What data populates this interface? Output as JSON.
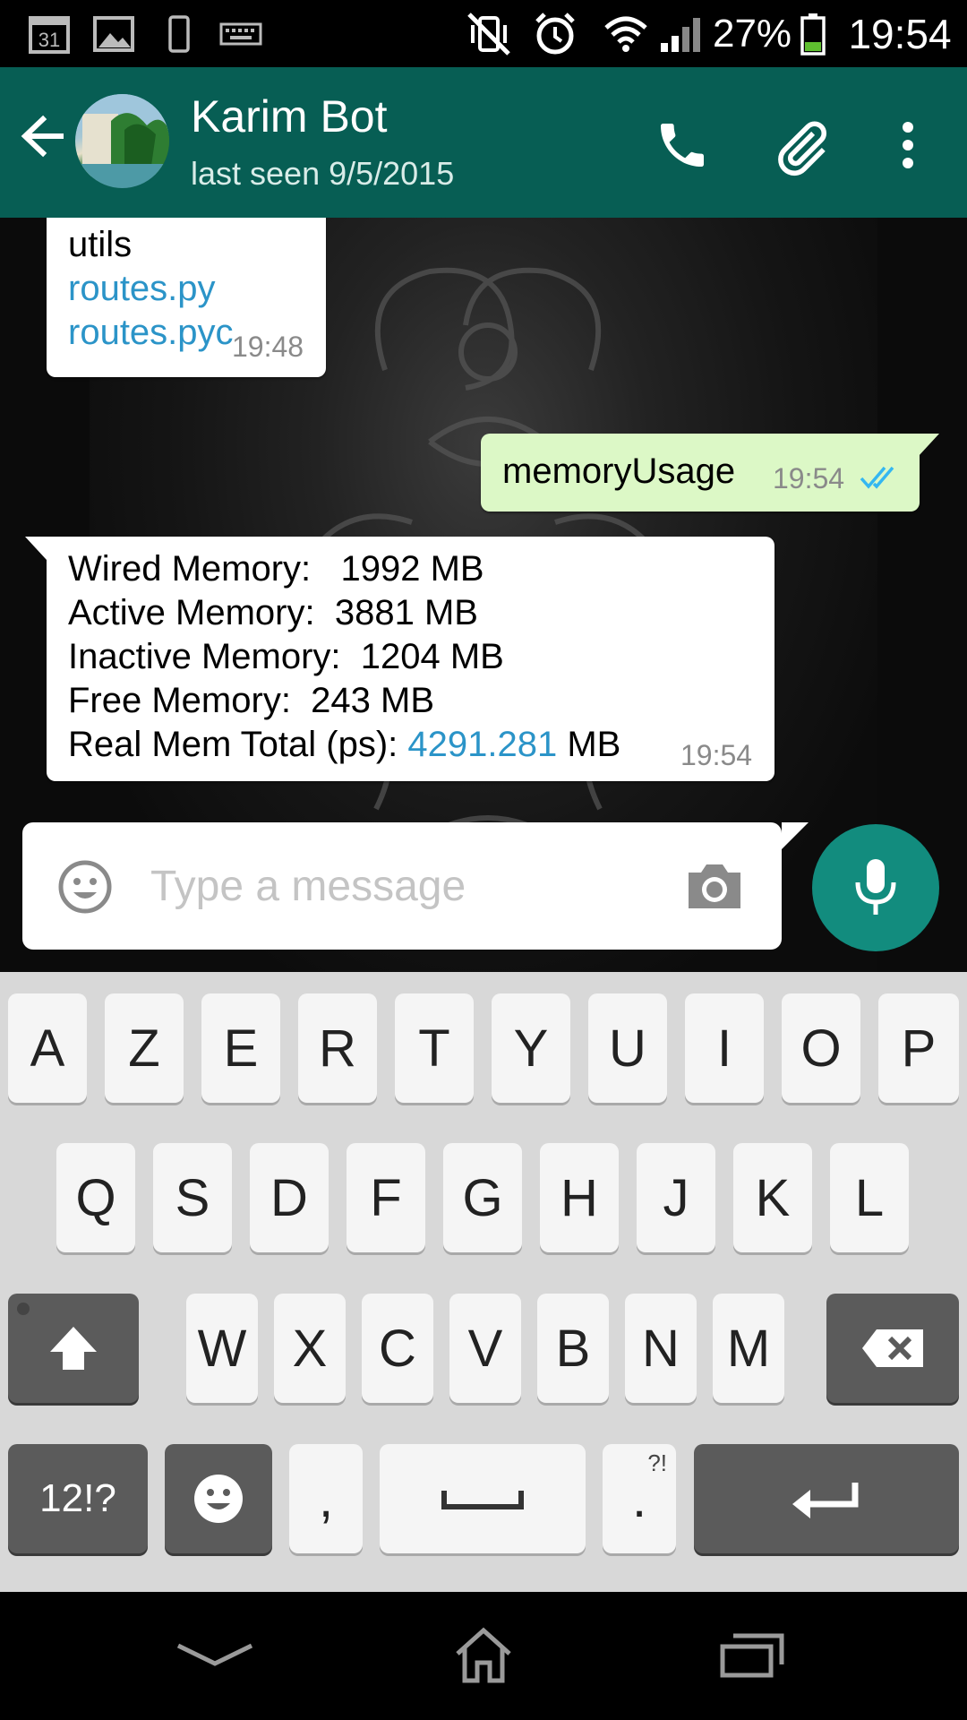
{
  "status_bar": {
    "battery": "27%",
    "time": "19:54",
    "calendar_day": "31"
  },
  "header": {
    "contact_name": "Karim Bot",
    "last_seen": "last seen 9/5/2015"
  },
  "messages": [
    {
      "direction": "incoming",
      "lines": [
        "utils",
        "routes.py",
        "routes.pyc"
      ],
      "time": "19:48"
    },
    {
      "direction": "outgoing",
      "text": "memoryUsage",
      "time": "19:54",
      "status": "read"
    },
    {
      "direction": "incoming",
      "lines": [
        {
          "label": "Wired Memory:",
          "value": "1992 MB"
        },
        {
          "label": "Active Memory:",
          "value": "3881 MB"
        },
        {
          "label": "Inactive Memory:",
          "value": "1204 MB"
        },
        {
          "label": "Free Memory:",
          "value": "243 MB"
        },
        {
          "label": "Real Mem Total (ps):",
          "link_value": "4291.281",
          "unit": "MB"
        }
      ],
      "time": "19:54"
    }
  ],
  "composer": {
    "placeholder": "Type a message"
  },
  "keyboard": {
    "row1": [
      "A",
      "Z",
      "E",
      "R",
      "T",
      "Y",
      "U",
      "I",
      "O",
      "P"
    ],
    "row2": [
      "Q",
      "S",
      "D",
      "F",
      "G",
      "H",
      "J",
      "K",
      "L"
    ],
    "row3": [
      "W",
      "X",
      "C",
      "V",
      "B",
      "N",
      "M"
    ],
    "symbols_label": "12!?",
    "comma": ",",
    "period": ".",
    "period_hint": "?!"
  },
  "colors": {
    "app_bar": "#075e54",
    "accent": "#128c7e",
    "outgoing_bubble": "#dcf8c6",
    "link": "#2b94c8",
    "read_ticks": "#34b7f1"
  }
}
